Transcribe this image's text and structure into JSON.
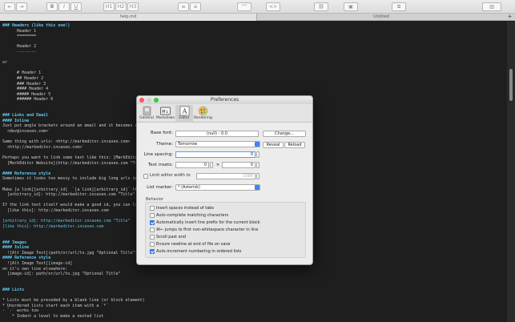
{
  "toolbar": {
    "buttons": [
      {
        "name": "outdent-button",
        "label": "⇤"
      },
      {
        "name": "indent-button",
        "label": "⇥"
      },
      {
        "name": "bold-button",
        "label": "B"
      },
      {
        "name": "italic-button",
        "label": "I"
      },
      {
        "name": "underline-button",
        "label": "U"
      },
      {
        "name": "h1-button",
        "label": "H1"
      },
      {
        "name": "h2-button",
        "label": "H2"
      },
      {
        "name": "h3-button",
        "label": "H3"
      },
      {
        "name": "ordered-list-button",
        "label": "≡"
      },
      {
        "name": "unordered-list-button",
        "label": "≡"
      },
      {
        "name": "quote-button",
        "label": "“”"
      },
      {
        "name": "code-button",
        "label": "<>"
      },
      {
        "name": "link-button",
        "label": "⛓"
      },
      {
        "name": "image-button",
        "label": "▣"
      },
      {
        "name": "copy-html-button",
        "label": "⧉"
      },
      {
        "name": "layout-button",
        "label": "▥"
      }
    ]
  },
  "tabs": {
    "items": [
      "help.md",
      "Untitled"
    ],
    "active_index": 0,
    "add_label": "+"
  },
  "editor": {
    "lines": [
      {
        "text": "### Headers (like this one!)",
        "style": "h"
      },
      {
        "text": "      Header 1",
        "style": ""
      },
      {
        "text": "      ========",
        "style": ""
      },
      {
        "text": "",
        "style": ""
      },
      {
        "text": "      Header 2",
        "style": ""
      },
      {
        "text": "      --------",
        "style": ""
      },
      {
        "text": "",
        "style": ""
      },
      {
        "text": "or",
        "style": ""
      },
      {
        "text": "",
        "style": ""
      },
      {
        "text": "      # Header 1",
        "style": ""
      },
      {
        "text": "      ## Header 2",
        "style": ""
      },
      {
        "text": "      ### Header 3",
        "style": ""
      },
      {
        "text": "      #### Header 4",
        "style": ""
      },
      {
        "text": "      ##### Header 5",
        "style": ""
      },
      {
        "text": "      ###### Header 6",
        "style": ""
      },
      {
        "text": "",
        "style": ""
      },
      {
        "text": "",
        "style": ""
      },
      {
        "text": "### Links and Email",
        "style": "h"
      },
      {
        "text": "#### Inline",
        "style": "h"
      },
      {
        "text": "Just put angle brackets around an email and it becomes clickable: <d",
        "style": ""
      },
      {
        "text": "  <dev@incaseo.com>`",
        "style": ""
      },
      {
        "text": "",
        "style": ""
      },
      {
        "text": "Same thing with urls: <http://markeditor.incaseo.com>",
        "style": ""
      },
      {
        "text": "  <http://markeditor.incaseo.com>`",
        "style": ""
      },
      {
        "text": "",
        "style": ""
      },
      {
        "text": "Perhaps you want to link some text like this: [MarkEditor Website](http",
        "style": ""
      },
      {
        "text": "  [MarkEditor Website](http://markeditor.incaseo.com \"Title\")` (The title",
        "style": ""
      },
      {
        "text": "",
        "style": ""
      },
      {
        "text": "#### Reference style",
        "style": "h"
      },
      {
        "text": "Sometimes it looks too messy to include big long urls inline, or you wa",
        "style": ""
      },
      {
        "text": "",
        "style": ""
      },
      {
        "text": "Make [a link][arbitrary_id]  `[a link][arbitrary_id]` then on it's own line an",
        "style": ""
      },
      {
        "text": "  [arbitrary_id]: http://markeditor.incaseo.com \"Title\"",
        "style": ""
      },
      {
        "text": "",
        "style": ""
      },
      {
        "text": "If the link text itself would make a good id, you can link [like this][]  [like",
        "style": ""
      },
      {
        "text": "  [like this]: http://markeditor.incaseo.com",
        "style": ""
      },
      {
        "text": "",
        "style": ""
      },
      {
        "text": "[arbitrary_id]: http://markeditor.incaseo.com \"Title\"",
        "style": "link"
      },
      {
        "text": "[like this]: http://markeditor.incaseo.com",
        "style": "link"
      },
      {
        "text": "",
        "style": ""
      },
      {
        "text": "",
        "style": ""
      },
      {
        "text": "### Images",
        "style": "h"
      },
      {
        "text": "#### Inline",
        "style": "h"
      },
      {
        "text": "  ![Alt Image Text](path/or/url/to.jpg \"Optional Title\")",
        "style": ""
      },
      {
        "text": "#### Reference style",
        "style": "h"
      },
      {
        "text": "  ![Alt Image Text][image-id]",
        "style": ""
      },
      {
        "text": "on it's own line elsewhere:",
        "style": ""
      },
      {
        "text": "  [image-id]: path/or/url/to.jpg \"Optional Title\"",
        "style": ""
      },
      {
        "text": "",
        "style": ""
      },
      {
        "text": "",
        "style": ""
      },
      {
        "text": "### Lists",
        "style": "h"
      },
      {
        "text": "",
        "style": ""
      },
      {
        "text": "* Lists must be preceded by a blank line (or block element)",
        "style": ""
      },
      {
        "text": "* Unordered lists start each item with a `*`",
        "style": ""
      },
      {
        "text": "- `-` works too",
        "style": ""
      },
      {
        "text": "    * Indent a level to make a nested list",
        "style": ""
      }
    ]
  },
  "dialog": {
    "title": "Preferences",
    "tabs": [
      {
        "name": "general",
        "label": "General"
      },
      {
        "name": "markdown",
        "label": "Markdown"
      },
      {
        "name": "editor",
        "label": "Editor"
      },
      {
        "name": "rendering",
        "label": "Rendering"
      }
    ],
    "active_tab": "editor",
    "base_font_label": "Base font:",
    "base_font_value": "(null) - 0.0",
    "change_label": "Change...",
    "theme_label": "Theme:",
    "theme_value": "Tomorrow",
    "reveal_label": "Reveal",
    "reload_label": "Reload",
    "line_spacing_label": "Line spacing:",
    "line_spacing_value": "0",
    "text_insets_label": "Text insets:",
    "inset_x": "0",
    "times": "×",
    "inset_y": "0",
    "limit_label": "Limit editor width to",
    "limit_value": "1000",
    "list_marker_label": "List marker:",
    "list_marker_value": "* (Asterisk)",
    "behavior_label": "Behavior",
    "options": [
      {
        "label": "Insert spaces instead of tabs",
        "checked": false
      },
      {
        "label": "Auto-complete matching characters",
        "checked": false
      },
      {
        "label": "Automatically insert line prefix for the current block",
        "checked": true
      },
      {
        "label": "⌘← jumps to first non-whitespace character in line",
        "checked": false
      },
      {
        "label": "Scroll past end",
        "checked": false
      },
      {
        "label": "Ensure newline at end of file on save",
        "checked": false
      },
      {
        "label": "Auto-increment numbering in ordered lists",
        "checked": true
      }
    ]
  }
}
